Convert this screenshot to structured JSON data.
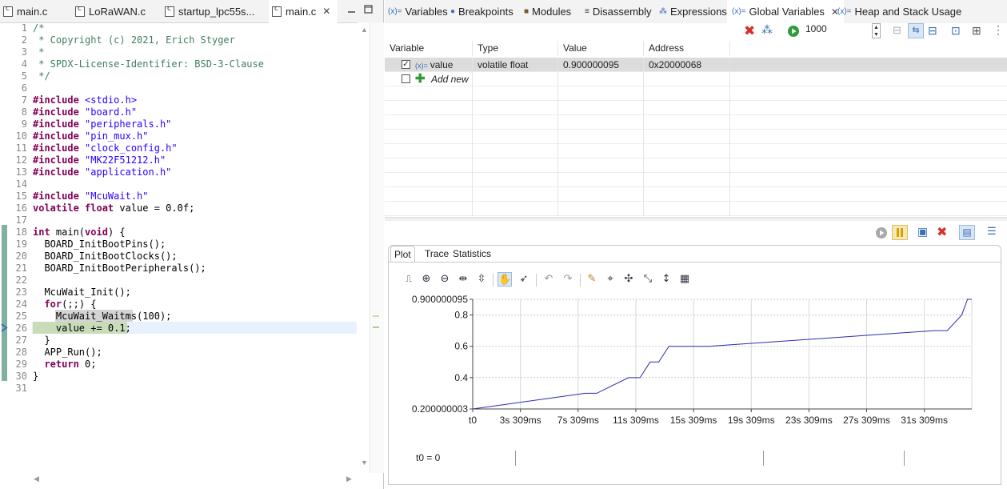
{
  "editor": {
    "tabs": [
      {
        "label": "main.c",
        "active": false
      },
      {
        "label": "LoRaWAN.c",
        "active": false
      },
      {
        "label": "startup_lpc55s...",
        "active": false
      },
      {
        "label": "main.c",
        "active": true
      }
    ],
    "lines": [
      {
        "n": "1",
        "text": "/*"
      },
      {
        "n": "2",
        "text": " * Copyright (c) 2021, Erich Styger"
      },
      {
        "n": "3",
        "text": " *"
      },
      {
        "n": "4",
        "text": " * SPDX-License-Identifier: BSD-3-Clause"
      },
      {
        "n": "5",
        "text": " */"
      },
      {
        "n": "6",
        "text": ""
      },
      {
        "n": "7",
        "text": "#include <stdio.h>"
      },
      {
        "n": "8",
        "text": "#include \"board.h\""
      },
      {
        "n": "9",
        "text": "#include \"peripherals.h\""
      },
      {
        "n": "10",
        "text": "#include \"pin_mux.h\""
      },
      {
        "n": "11",
        "text": "#include \"clock_config.h\""
      },
      {
        "n": "12",
        "text": "#include \"MK22F51212.h\""
      },
      {
        "n": "13",
        "text": "#include \"application.h\""
      },
      {
        "n": "14",
        "text": ""
      },
      {
        "n": "15",
        "text": "#include \"McuWait.h\""
      },
      {
        "n": "16",
        "text": "volatile float value = 0.0f;"
      },
      {
        "n": "17",
        "text": ""
      },
      {
        "n": "18",
        "text": "int main(void) {"
      },
      {
        "n": "19",
        "text": "  BOARD_InitBootPins();"
      },
      {
        "n": "20",
        "text": "  BOARD_InitBootClocks();"
      },
      {
        "n": "21",
        "text": "  BOARD_InitBootPeripherals();"
      },
      {
        "n": "22",
        "text": ""
      },
      {
        "n": "23",
        "text": "  McuWait_Init();"
      },
      {
        "n": "24",
        "text": "  for(;;) {"
      },
      {
        "n": "25",
        "text": "    McuWait_Waitms(100);"
      },
      {
        "n": "26",
        "text": "    value += 0.1;"
      },
      {
        "n": "27",
        "text": "  }"
      },
      {
        "n": "28",
        "text": "  APP_Run();"
      },
      {
        "n": "29",
        "text": "  return 0;"
      },
      {
        "n": "30",
        "text": "}"
      },
      {
        "n": "31",
        "text": ""
      }
    ]
  },
  "views": {
    "tabs": [
      {
        "label": "Variables",
        "icon": "(x)="
      },
      {
        "label": "Breakpoints",
        "icon": "●"
      },
      {
        "label": "Modules",
        "icon": "■"
      },
      {
        "label": "Disassembly",
        "icon": "≡"
      },
      {
        "label": "Expressions",
        "icon": "⁂"
      },
      {
        "label": "Global Variables",
        "icon": "(x)=",
        "active": true
      },
      {
        "label": "Heap and Stack Usage",
        "icon": "(x)="
      }
    ],
    "refresh_rate": "1000"
  },
  "globals_table": {
    "headers": [
      "Variable",
      "Type",
      "Value",
      "Address"
    ],
    "rows": [
      {
        "checked": true,
        "name": "value",
        "type": "volatile float",
        "value": "0.900000095",
        "address": "0x20000068"
      }
    ],
    "add_new": "Add new"
  },
  "plot": {
    "tabs": [
      "Plot",
      "Trace",
      "Statistics"
    ],
    "t0_label": "t0 = 0"
  },
  "chart_data": {
    "type": "line",
    "series": [
      {
        "values_x": [
          0,
          7.8,
          8.6,
          10.8,
          11.6,
          12.3,
          12.9,
          13.6,
          16.4,
          32.0,
          32.9,
          33.9,
          34.3,
          34.6
        ],
        "values_y": [
          0.200000003,
          0.3,
          0.3,
          0.4,
          0.4,
          0.5,
          0.5,
          0.6,
          0.6,
          0.7,
          0.7,
          0.8,
          0.900000095,
          0.900000095
        ]
      }
    ],
    "x_ticks": [
      "t0",
      "3s 309ms",
      "7s 309ms",
      "11s 309ms",
      "15s 309ms",
      "19s 309ms",
      "23s 309ms",
      "27s 309ms",
      "31s 309ms"
    ],
    "x_tick_values": [
      0,
      3.309,
      7.309,
      11.309,
      15.309,
      19.309,
      23.309,
      27.309,
      31.309
    ],
    "y_ticks": [
      "0.200000003",
      "0.4",
      "0.6",
      "0.8",
      "0.900000095"
    ],
    "y_tick_values": [
      0.200000003,
      0.4,
      0.6,
      0.8,
      0.900000095
    ],
    "xlim": [
      0,
      34.6
    ],
    "ylim": [
      0.200000003,
      0.900000095
    ],
    "grid": true,
    "line_color": "#2b2bb3"
  }
}
